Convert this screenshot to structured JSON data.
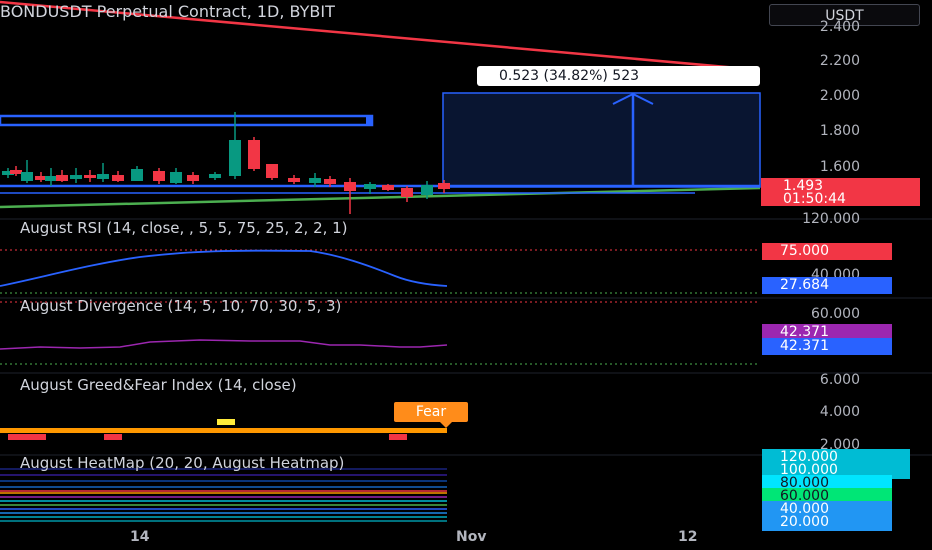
{
  "header": {
    "title": "BONDUSDT Perpetual Contract, 1D, BYBIT",
    "currency_button": "USDT"
  },
  "measure_label": "0.523 (34.82%) 523",
  "price_axis": {
    "ticks": [
      "2.400",
      "2.200",
      "2.000",
      "1.800",
      "1.600"
    ],
    "last_price": "1.493",
    "countdown": "01:50:44",
    "colors": {
      "last_badge": "#f23645",
      "resistance": "#f23645",
      "support": "#4caf50",
      "box": "#2962ff"
    }
  },
  "panels": {
    "rsi": {
      "title": "August RSI (14, close, , 5, 5, 75, 25, 2, 2, 1)",
      "top_tick": "120.000",
      "mid_tick": "40.000",
      "badge_upper": "75.000",
      "badge_value": "27.684"
    },
    "divergence": {
      "title": "August Divergence (14, 5, 10, 70, 30, 5, 3)",
      "tick": "60.000",
      "badge_a": "42.371",
      "badge_b": "42.371"
    },
    "greed_fear": {
      "title": "August Greed&Fear Index (14, close)",
      "ticks": [
        "6.000",
        "4.000",
        "2.000"
      ],
      "label": "Fear"
    },
    "heatmap": {
      "title": "August HeatMap (20, 20, August Heatmap)",
      "badges": [
        "120.000",
        "100.000",
        "80.000",
        "60.000",
        "40.000",
        "20.000"
      ]
    }
  },
  "time_axis": {
    "labels": [
      "14",
      "Nov",
      "12"
    ]
  }
}
